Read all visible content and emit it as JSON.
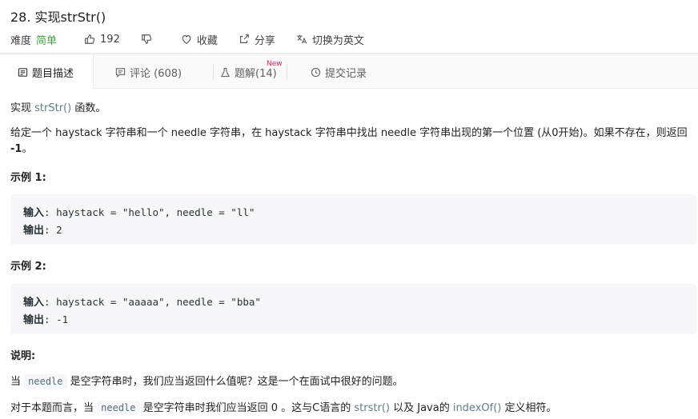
{
  "header": {
    "title": "28. 实现strStr()",
    "difficulty_label": "难度",
    "difficulty": "简单",
    "likes": "192",
    "favorite_label": "收藏",
    "share_label": "分享",
    "translate_label": "切换为英文"
  },
  "tabs": {
    "description": "题目描述",
    "discuss": "评论 (608)",
    "solutions": "题解(14)",
    "solutions_badge": "New",
    "submissions": "提交记录"
  },
  "body": {
    "p1_pre": "实现 ",
    "p1_link": "strStr()",
    "p1_post": " 函数。",
    "p2_main": "给定一个 haystack 字符串和一个 needle 字符串，在 haystack 字符串中找出 needle 字符串出现的第一个位置 (从0开始)。如果不存在，则返回 ",
    "p2_bold": "-1",
    "p2_end": "。",
    "ex1_heading": "示例 1:",
    "ex1_input_label": "输入",
    "ex1_input": ": haystack = \"hello\", needle = \"ll\"",
    "ex1_output_label": "输出",
    "ex1_output": ": 2",
    "ex2_heading": "示例 2:",
    "ex2_input_label": "输入",
    "ex2_input": ": haystack = \"aaaaa\", needle = \"bba\"",
    "ex2_output_label": "输出",
    "ex2_output": ": -1",
    "note_heading": "说明:",
    "p3_pre": "当 ",
    "p3_code": "needle",
    "p3_post": " 是空字符串时，我们应当返回什么值呢？这是一个在面试中很好的问题。",
    "p4_pre": "对于本题而言，当 ",
    "p4_code": "needle",
    "p4_mid": " 是空字符串时我们应当返回 0 。这与C语言的 ",
    "p4_link1": "strstr()",
    "p4_mid2": " 以及 Java的 ",
    "p4_link2": "indexOf()",
    "p4_end": " 定义相符。"
  },
  "colors": {
    "easy": "#43a047",
    "link": "#607d8b",
    "new_badge": "#e91e63"
  }
}
